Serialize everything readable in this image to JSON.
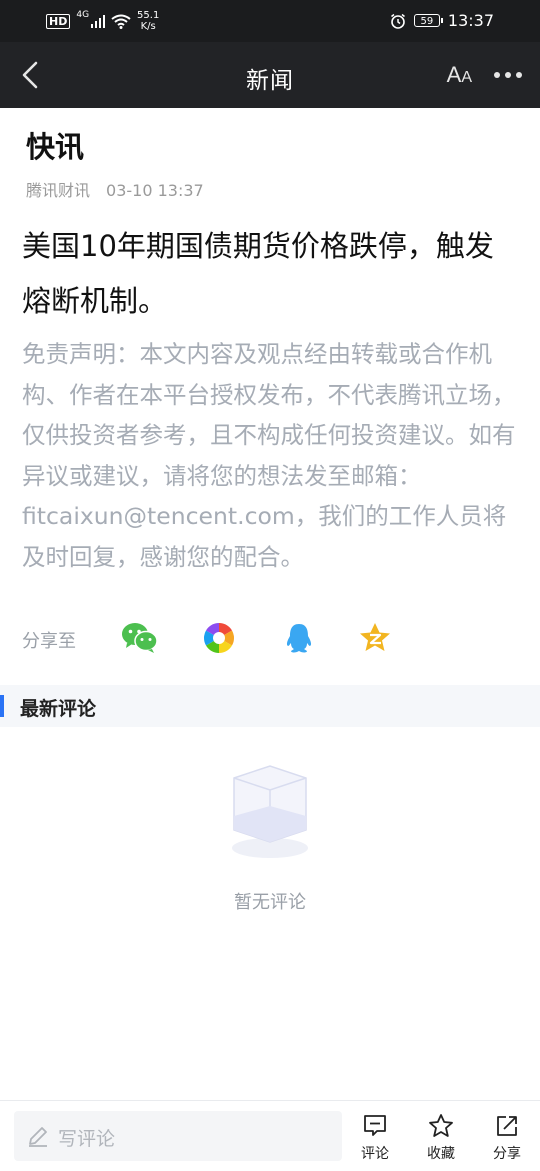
{
  "status_bar": {
    "network": "HD",
    "network_gen": "4G",
    "speed_value": "55.1",
    "speed_unit": "K/s",
    "battery": "59",
    "time": "13:37"
  },
  "nav": {
    "title": "新闻",
    "font_size_label_large": "A",
    "font_size_label_small": "A"
  },
  "article": {
    "section_title": "快讯",
    "source": "腾讯财讯",
    "datetime": "03-10 13:37",
    "headline": "美国10年期国债期货价格跌停，触发熔断机制。",
    "disclaimer": "免责声明：本文内容及观点经由转载或合作机构、作者在本平台授权发布，不代表腾讯立场，仅供投资者参考，且不构成任何投资建议。如有异议或建议，请将您的想法发至邮箱：fitcaixun@tencent.com，我们的工作人员将及时回复，感谢您的配合。"
  },
  "share": {
    "label": "分享至",
    "targets": [
      "wechat-icon",
      "moments-icon",
      "qq-icon",
      "qzone-icon"
    ]
  },
  "comments": {
    "title": "最新评论",
    "empty_text": "暂无评论"
  },
  "bottom_bar": {
    "input_placeholder": "写评论",
    "comment_label": "评论",
    "favorite_label": "收藏",
    "share_label": "分享"
  },
  "colors": {
    "nav_background": "#222326",
    "status_background": "#1b1c1e",
    "accent": "#2a73f5",
    "wechat": "#4cbf4f",
    "qq": "#3aa7f2",
    "qzone": "#f2b521",
    "muted_text": "#a6acb5"
  }
}
